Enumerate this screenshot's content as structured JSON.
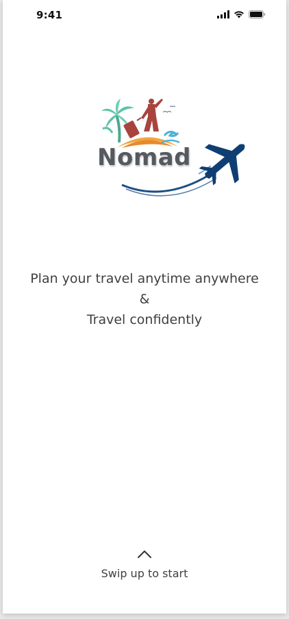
{
  "status_bar": {
    "time": "9:41",
    "icons": [
      "signal-icon",
      "wifi-icon",
      "battery-icon"
    ]
  },
  "logo": {
    "text": "Nomad",
    "colors": {
      "palm": "#5fc2a9",
      "traveler": "#a8443e",
      "sun": "#f0a640",
      "wave": "#4db3d6",
      "plane": "#0f3e73",
      "text": "#555a60"
    }
  },
  "tagline": {
    "line1": "Plan your travel anytime anywhere",
    "line2": "&",
    "line3": "Travel confidently"
  },
  "swipe": {
    "label": "Swip up to start",
    "icon": "chevron-up-icon"
  }
}
